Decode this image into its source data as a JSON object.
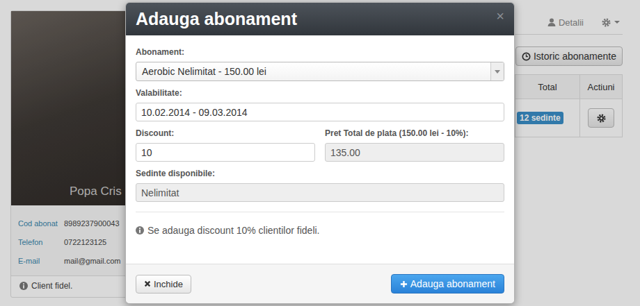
{
  "page": {
    "profile": {
      "caption": "Popa Cris",
      "fields": [
        {
          "label": "Cod abonat",
          "value": "8989237900043"
        },
        {
          "label": "Telefon",
          "value": "0722123125"
        },
        {
          "label": "E-mail",
          "value": "mail@gmail.com"
        }
      ],
      "note": "Client fidel."
    },
    "toolbar": {
      "details": "Detalii"
    },
    "history_button": "Istoric abonamente",
    "table": {
      "columns": [
        "Total",
        "Actiuni"
      ],
      "rows": [
        {
          "total": "12 sedinte"
        }
      ]
    }
  },
  "modal": {
    "title": "Adauga abonament",
    "close": "×",
    "rows": [
      [
        {
          "label": "Abonament:",
          "value": "Aerobic Nelimitat - 150.00 lei",
          "kind": "select",
          "readonly": false
        }
      ],
      [
        {
          "label": "Valabilitate:",
          "value": "10.02.2014 - 09.03.2014",
          "kind": "input",
          "readonly": false
        }
      ],
      [
        {
          "label": "Discount:",
          "value": "10",
          "kind": "input",
          "readonly": false
        },
        {
          "label": "Pret Total de plata (150.00 lei - 10%):",
          "value": "135.00",
          "kind": "input",
          "readonly": true
        }
      ],
      [
        {
          "label": "Sedinte disponibile:",
          "value": "Nelimitat",
          "kind": "input",
          "readonly": true
        }
      ]
    ],
    "info": "Se adauga discount 10% clientilor fideli.",
    "buttons": [
      {
        "label": "Inchide",
        "primary": false
      },
      {
        "label": "Adauga abonament",
        "primary": true
      }
    ]
  }
}
